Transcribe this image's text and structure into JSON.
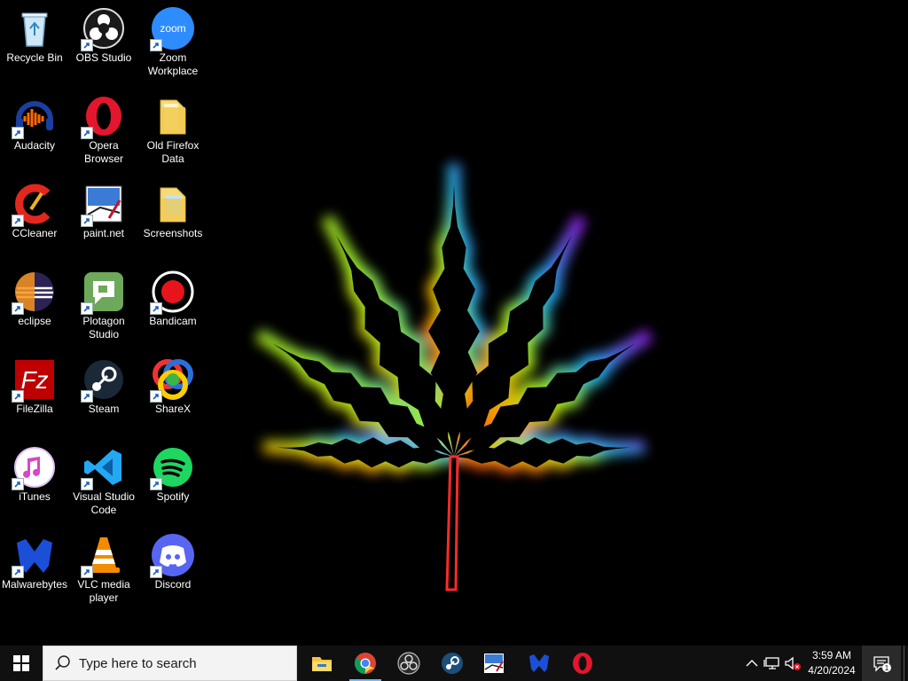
{
  "desktop": {
    "icons": [
      {
        "label": "Recycle Bin",
        "icon": "recycle-bin-icon"
      },
      {
        "label": "OBS Studio",
        "icon": "obs-studio-icon"
      },
      {
        "label": "Zoom Workplace",
        "icon": "zoom-icon"
      },
      {
        "label": "Audacity",
        "icon": "audacity-icon"
      },
      {
        "label": "Opera Browser",
        "icon": "opera-icon"
      },
      {
        "label": "Old Firefox Data",
        "icon": "folder-icon"
      },
      {
        "label": "CCleaner",
        "icon": "ccleaner-icon"
      },
      {
        "label": "paint.net",
        "icon": "paint-net-icon"
      },
      {
        "label": "Screenshots",
        "icon": "folder-icon"
      },
      {
        "label": "eclipse",
        "icon": "eclipse-icon"
      },
      {
        "label": "Plotagon Studio",
        "icon": "plotagon-icon"
      },
      {
        "label": "Bandicam",
        "icon": "bandicam-icon"
      },
      {
        "label": "FileZilla",
        "icon": "filezilla-icon"
      },
      {
        "label": "Steam",
        "icon": "steam-icon"
      },
      {
        "label": "ShareX",
        "icon": "sharex-icon"
      },
      {
        "label": "iTunes",
        "icon": "itunes-icon"
      },
      {
        "label": "Visual Studio Code",
        "icon": "vscode-icon"
      },
      {
        "label": "Spotify",
        "icon": "spotify-icon"
      },
      {
        "label": "Malwarebytes",
        "icon": "malwarebytes-icon"
      },
      {
        "label": "VLC media player",
        "icon": "vlc-icon"
      },
      {
        "label": "Discord",
        "icon": "discord-icon"
      }
    ],
    "wallpaper": "cannabis-leaf-wallpaper"
  },
  "taskbar": {
    "search_placeholder": "Type here to search",
    "pinned": [
      "file-explorer-icon",
      "chrome-icon",
      "obs-studio-icon",
      "steam-icon",
      "paint-net-icon",
      "malwarebytes-icon",
      "opera-icon"
    ],
    "clock": {
      "time": "3:59 AM",
      "date": "4/20/2024"
    },
    "notification_count": "1"
  },
  "colors": {
    "taskbar": "#101010",
    "search_bg": "#f3f3f3",
    "accent": "#76b9ed"
  }
}
